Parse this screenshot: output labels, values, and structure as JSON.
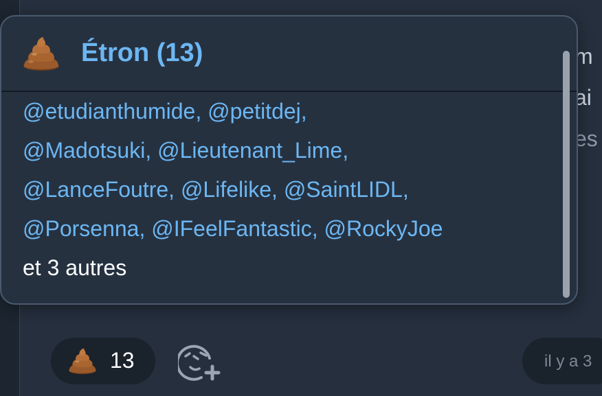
{
  "background_text": {
    "line1": "m",
    "line2": "ai",
    "line3": "es"
  },
  "popover": {
    "emoji_icon": "poop-emoji",
    "title": "Étron (13)",
    "users": [
      "@etudianthumide",
      "@petitdej",
      "@Madotsuki",
      "@Lieutenant_Lime",
      "@LanceFoutre",
      "@Lifelike",
      "@SaintLIDL",
      "@Porsenna",
      "@IFeelFantastic",
      "@RockyJoe"
    ],
    "more_text": "et 3 autres"
  },
  "reactions": {
    "poop": {
      "icon": "poop-emoji",
      "count": "13"
    },
    "add_icon": "add-reaction-icon"
  },
  "timestamp": "il y a 3",
  "colors": {
    "accent": "#6cb7f3",
    "background": "#252f3d",
    "popover_bg": "#263140",
    "pill_bg": "#1a222c"
  }
}
